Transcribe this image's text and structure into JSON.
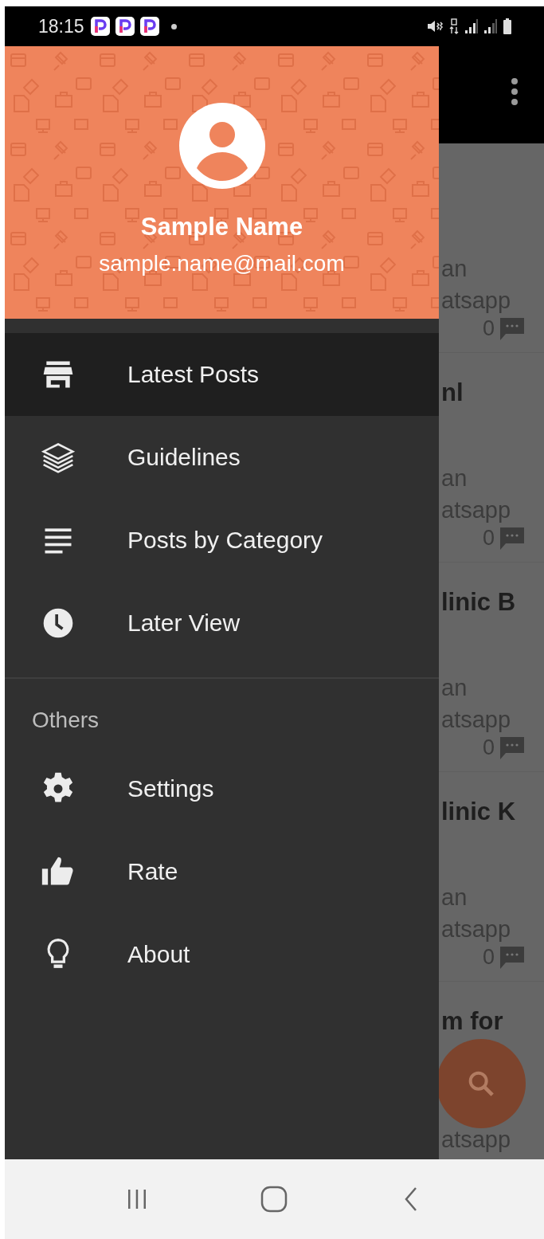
{
  "status_bar": {
    "time": "18:15"
  },
  "background": {
    "posts": [
      {
        "lines": [
          "an",
          "atsapp"
        ],
        "count": "0"
      },
      {
        "title": "nl",
        "lines": [
          "an",
          "atsapp"
        ],
        "count": "0"
      },
      {
        "title": "linic B",
        "lines": [
          "an",
          "atsapp"
        ],
        "count": "0"
      },
      {
        "title": "linic K",
        "lines": [
          "an",
          "atsapp"
        ],
        "count": "0"
      },
      {
        "title": "m for",
        "lines": [
          "atsapp"
        ]
      }
    ]
  },
  "drawer": {
    "header": {
      "name": "Sample Name",
      "email": "sample.name@mail.com"
    },
    "sections": [
      {
        "items": [
          {
            "label": "Latest Posts",
            "selected": true
          },
          {
            "label": "Guidelines",
            "selected": false
          },
          {
            "label": "Posts by Category",
            "selected": false
          },
          {
            "label": "Later View",
            "selected": false
          }
        ]
      },
      {
        "title": "Others",
        "items": [
          {
            "label": "Settings",
            "selected": false
          },
          {
            "label": "Rate",
            "selected": false
          },
          {
            "label": "About",
            "selected": false
          }
        ]
      }
    ]
  }
}
